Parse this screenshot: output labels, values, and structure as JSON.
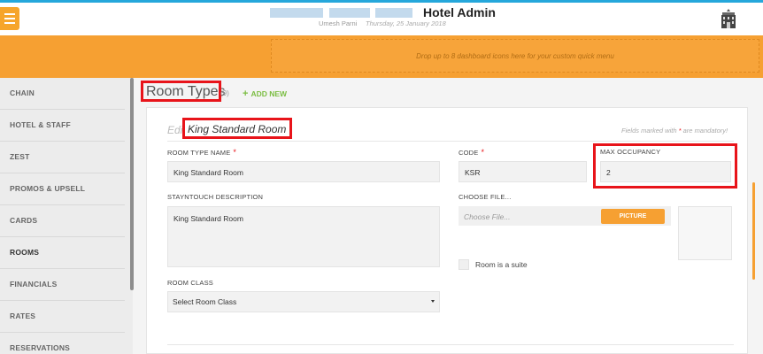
{
  "header": {
    "app_title": "Hotel Admin",
    "user_name": "Umesh Parni",
    "date": "Thursday, 25 January 2018",
    "menu_icon": "hamburger-icon",
    "hotel_icon": "hotel-building-icon",
    "accent_color": "#f6a032",
    "topline_color": "#25a7db"
  },
  "quick_menu": {
    "placeholder": "Drop up to 8 dashboard icons here for your custom quick menu"
  },
  "sidebar": {
    "items": [
      {
        "label": "CHAIN"
      },
      {
        "label": "HOTEL & STAFF"
      },
      {
        "label": "ZEST"
      },
      {
        "label": "PROMOS & UPSELL"
      },
      {
        "label": "CARDS"
      },
      {
        "label": "ROOMS",
        "active": true
      },
      {
        "label": "FINANCIALS"
      },
      {
        "label": "RATES"
      },
      {
        "label": "RESERVATIONS"
      }
    ]
  },
  "page": {
    "title": "Room Types",
    "count": "(9)",
    "add_new": "ADD NEW",
    "edit_prefix": "Edi",
    "edit_name": "King Standard Room",
    "mandatory_prefix": "Fields marked with",
    "mandatory_star": "*",
    "mandatory_suffix": "are mandatory!"
  },
  "form": {
    "room_type_name": {
      "label": "ROOM TYPE NAME",
      "value": "King Standard Room"
    },
    "code": {
      "label": "CODE",
      "value": "KSR"
    },
    "max_occupancy": {
      "label": "MAX OCCUPANCY",
      "value": "2"
    },
    "description": {
      "label": "STAYNTOUCH DESCRIPTION",
      "value": "King Standard Room"
    },
    "choose_file": {
      "label": "CHOOSE FILE...",
      "placeholder": "Choose File...",
      "button": "PICTURE"
    },
    "suite": {
      "label": "Room is a suite",
      "checked": false
    },
    "room_class": {
      "label": "ROOM CLASS",
      "value": "Select Room Class"
    }
  }
}
